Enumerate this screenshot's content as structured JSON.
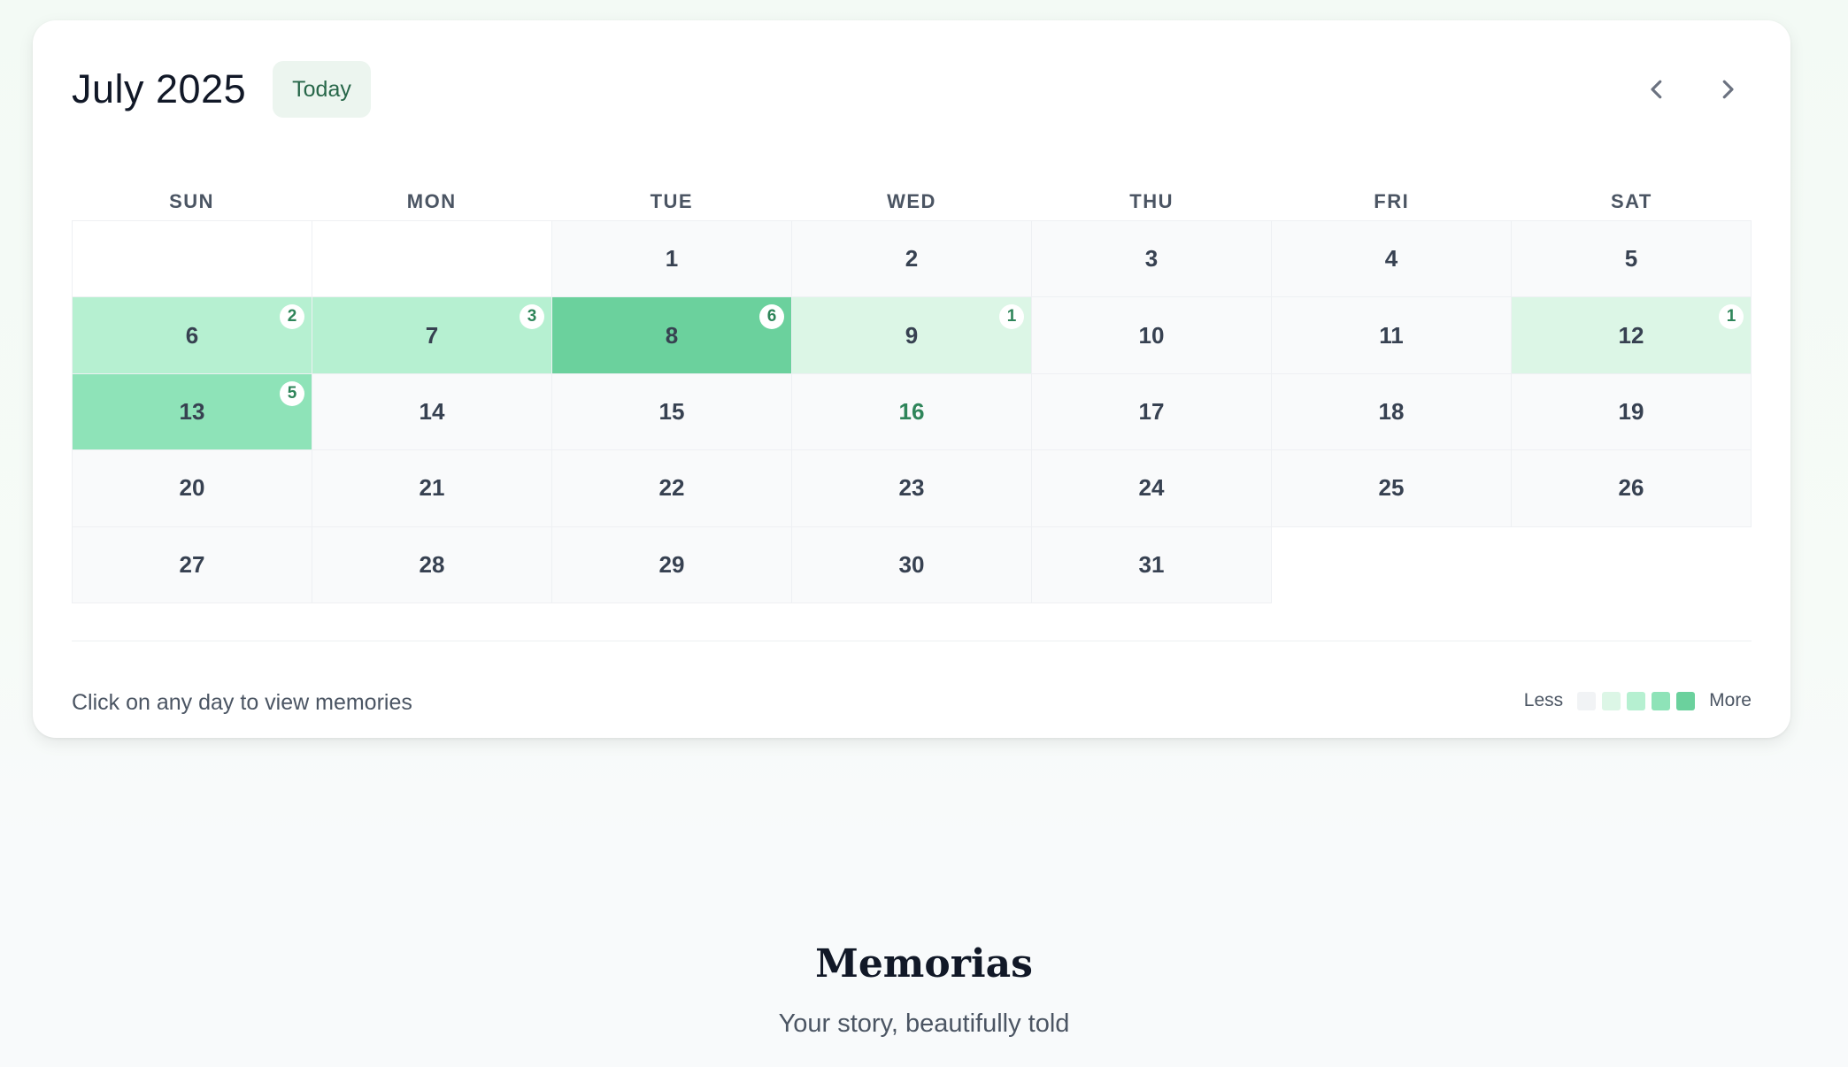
{
  "calendar": {
    "title": "July 2025",
    "today_label": "Today",
    "weekdays": [
      "SUN",
      "MON",
      "TUE",
      "WED",
      "THU",
      "FRI",
      "SAT"
    ],
    "days": [
      {
        "day": "",
        "level": -1
      },
      {
        "day": "",
        "level": -1
      },
      {
        "day": "1",
        "level": 0
      },
      {
        "day": "2",
        "level": 0
      },
      {
        "day": "3",
        "level": 0
      },
      {
        "day": "4",
        "level": 0
      },
      {
        "day": "5",
        "level": 0
      },
      {
        "day": "6",
        "level": 2,
        "count": "2"
      },
      {
        "day": "7",
        "level": 2,
        "count": "3"
      },
      {
        "day": "8",
        "level": 4,
        "count": "6"
      },
      {
        "day": "9",
        "level": 1,
        "count": "1"
      },
      {
        "day": "10",
        "level": 0
      },
      {
        "day": "11",
        "level": 0
      },
      {
        "day": "12",
        "level": 1,
        "count": "1"
      },
      {
        "day": "13",
        "level": 3,
        "count": "5"
      },
      {
        "day": "14",
        "level": 0
      },
      {
        "day": "15",
        "level": 0
      },
      {
        "day": "16",
        "level": 0,
        "today": true
      },
      {
        "day": "17",
        "level": 0
      },
      {
        "day": "18",
        "level": 0
      },
      {
        "day": "19",
        "level": 0
      },
      {
        "day": "20",
        "level": 0
      },
      {
        "day": "21",
        "level": 0
      },
      {
        "day": "22",
        "level": 0
      },
      {
        "day": "23",
        "level": 0
      },
      {
        "day": "24",
        "level": 0
      },
      {
        "day": "25",
        "level": 0
      },
      {
        "day": "26",
        "level": 0
      },
      {
        "day": "27",
        "level": 0
      },
      {
        "day": "28",
        "level": 0
      },
      {
        "day": "29",
        "level": 0
      },
      {
        "day": "30",
        "level": 0
      },
      {
        "day": "31",
        "level": 0
      }
    ],
    "hint": "Click on any day to view memories",
    "legend": {
      "less": "Less",
      "more": "More",
      "colors": [
        "#f1f3f5",
        "#dcf6e6",
        "#b6f0d1",
        "#8ee3b8",
        "#6bd19d"
      ]
    },
    "icons": {
      "prev": "chevron-left-icon",
      "next": "chevron-right-icon"
    }
  },
  "footer": {
    "brand": "Memorias",
    "tagline": "Your story, beautifully told"
  }
}
